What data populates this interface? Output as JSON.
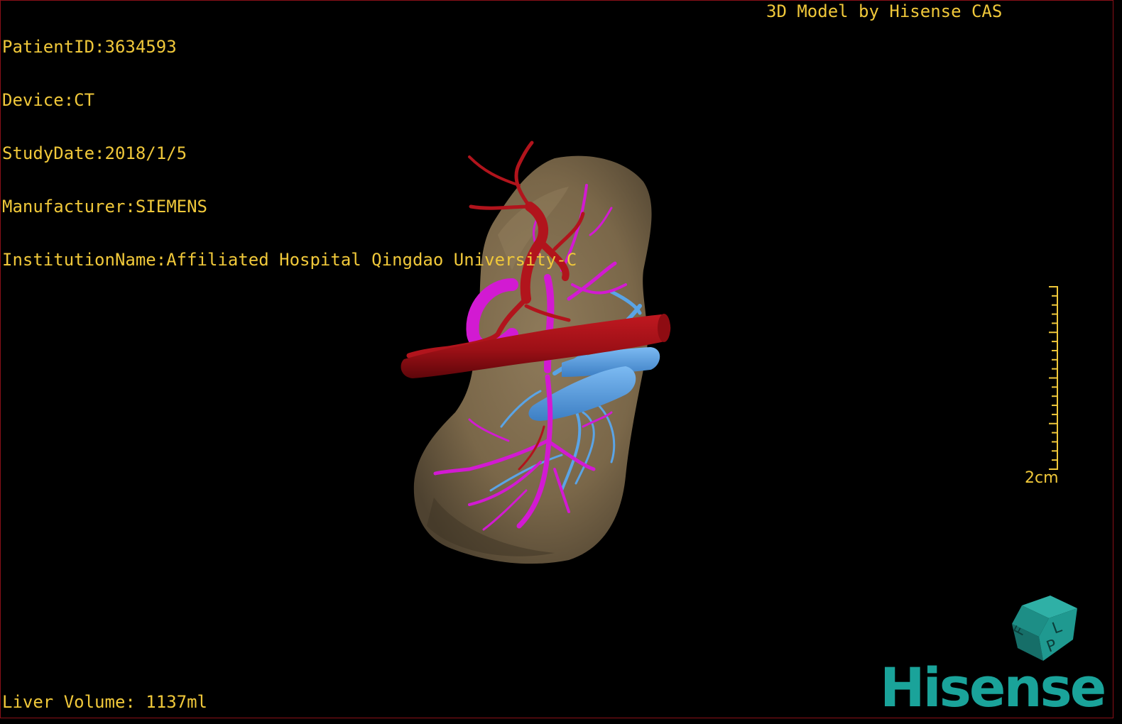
{
  "header": {
    "patient_id": "PatientID:3634593",
    "device": "Device:CT",
    "study_date": "StudyDate:2018/1/5",
    "manufacturer": "Manufacturer:SIEMENS",
    "institution": "InstitutionName:Affiliated Hospital Qingdao University-C",
    "credit": "3D Model by Hisense CAS"
  },
  "footer": {
    "liver_volume": "Liver Volume: 1137ml"
  },
  "scale": {
    "label": "2cm"
  },
  "orientation_cube": {
    "face_labels": [
      "L",
      "F",
      "P"
    ]
  },
  "brand": {
    "name": "Hisense"
  },
  "colors": {
    "overlay_text": "#f0c83a",
    "liver": "#7d6a4d",
    "artery": "#a8141c",
    "portal_vein": "#d21ad2",
    "hepatic_vein": "#5aa4e6",
    "brand": "#1aa39a",
    "border": "#8a1018"
  },
  "icons": [
    "orientation-cube-icon",
    "scale-bar-icon"
  ]
}
